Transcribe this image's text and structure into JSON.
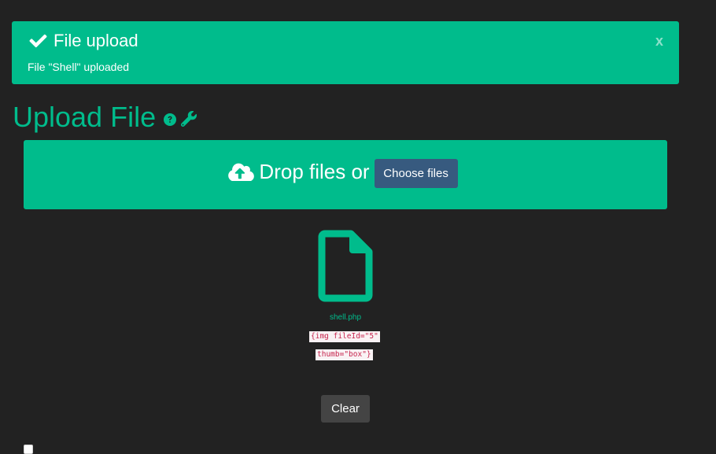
{
  "alert": {
    "title": "File upload",
    "message": "File \"Shell\" uploaded",
    "close_label": "x"
  },
  "page": {
    "title": "Upload File"
  },
  "dropzone": {
    "text": "Drop files or",
    "choose_button": "Choose files"
  },
  "uploaded_file": {
    "name": "shell.php",
    "syntax_line1": "{img fileId=\"5\"",
    "syntax_line2": "thumb=\"box\"}"
  },
  "actions": {
    "clear_button": "Clear"
  },
  "colors": {
    "background": "#222222",
    "accent": "#00bc8c",
    "primary_button": "#375a7f",
    "secondary_button": "#444444"
  },
  "icons": [
    "check-icon",
    "help-icon",
    "wrench-icon",
    "cloud-upload-icon",
    "file-icon"
  ]
}
